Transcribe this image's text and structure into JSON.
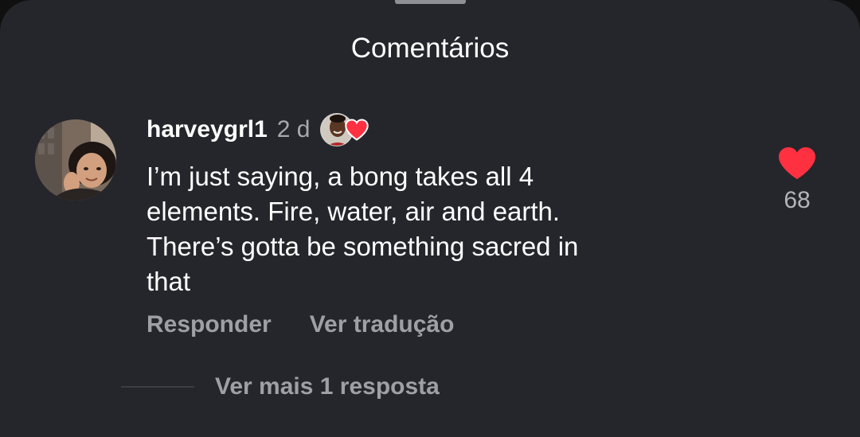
{
  "sheet": {
    "title": "Comentários"
  },
  "comment": {
    "username": "harveygrl1",
    "timestamp": "2 d",
    "text": "I’m just saying, a bong takes all 4\nelements. Fire, water, air and earth.\nThere’s gotta be something sacred in\nthat",
    "likes": "68",
    "liked": true,
    "liked_by_creator": true,
    "avatar_icon": "user-avatar",
    "creator_avatar_icon": "creator-avatar",
    "like_icon": "heart-filled-icon"
  },
  "actions": {
    "reply_label": "Responder",
    "translate_label": "Ver tradução"
  },
  "replies": {
    "label": "Ver mais 1 resposta"
  },
  "colors": {
    "background": "#25262b",
    "text_primary": "#ffffff",
    "text_secondary": "#9fa0a5",
    "like_red": "#ff3040"
  }
}
